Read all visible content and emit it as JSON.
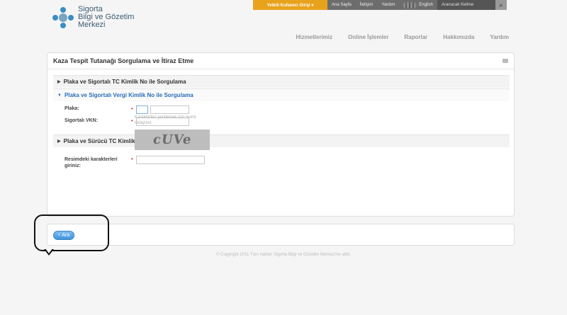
{
  "topbar": {
    "login_label": "Yetkili Kullanıcı Girişi ▾",
    "links": [
      "Ana Sayfa",
      "İletişim",
      "Yardım"
    ],
    "english_label": "English",
    "search_placeholder": "Aranacak Kelime"
  },
  "logo": {
    "line1": "Sigorta",
    "line2": "Bilgi ve Gözetim",
    "line3": "Merkezi"
  },
  "mainnav": {
    "items": [
      "Hizmetlerimiz",
      "Online İşlemler",
      "Raporlar",
      "Hakkımızda",
      "Yardım"
    ]
  },
  "panel": {
    "title": "Kaza Tespit Tutanağı Sorgulama ve İtiraz Etme",
    "sections": {
      "tc": "Plaka ve Sigortalı TC Kimlik No ile Sorgulama",
      "vkn": "Plaka ve Sigortalı Vergi Kimlik No ile Sorgulama",
      "surucu": "Plaka ve Sürücü TC Kimlik No ile Sorgulama"
    },
    "fields": {
      "plaka_label": "Plaka:",
      "vkn_label": "Sigortalı VKN:",
      "captcha_label": "Resimdeki karakterleri giriniz:",
      "captcha_hint": "Karakterleri yenilemek için resmi tıklayınız.",
      "captcha_text": "cUVe"
    }
  },
  "actions": {
    "search_label": "Ara"
  },
  "footer": {
    "copyright": "© Copyright 2011 Tüm hakları Sigorta Bilgi ve Gözetim Merkezi'ne aittir."
  }
}
